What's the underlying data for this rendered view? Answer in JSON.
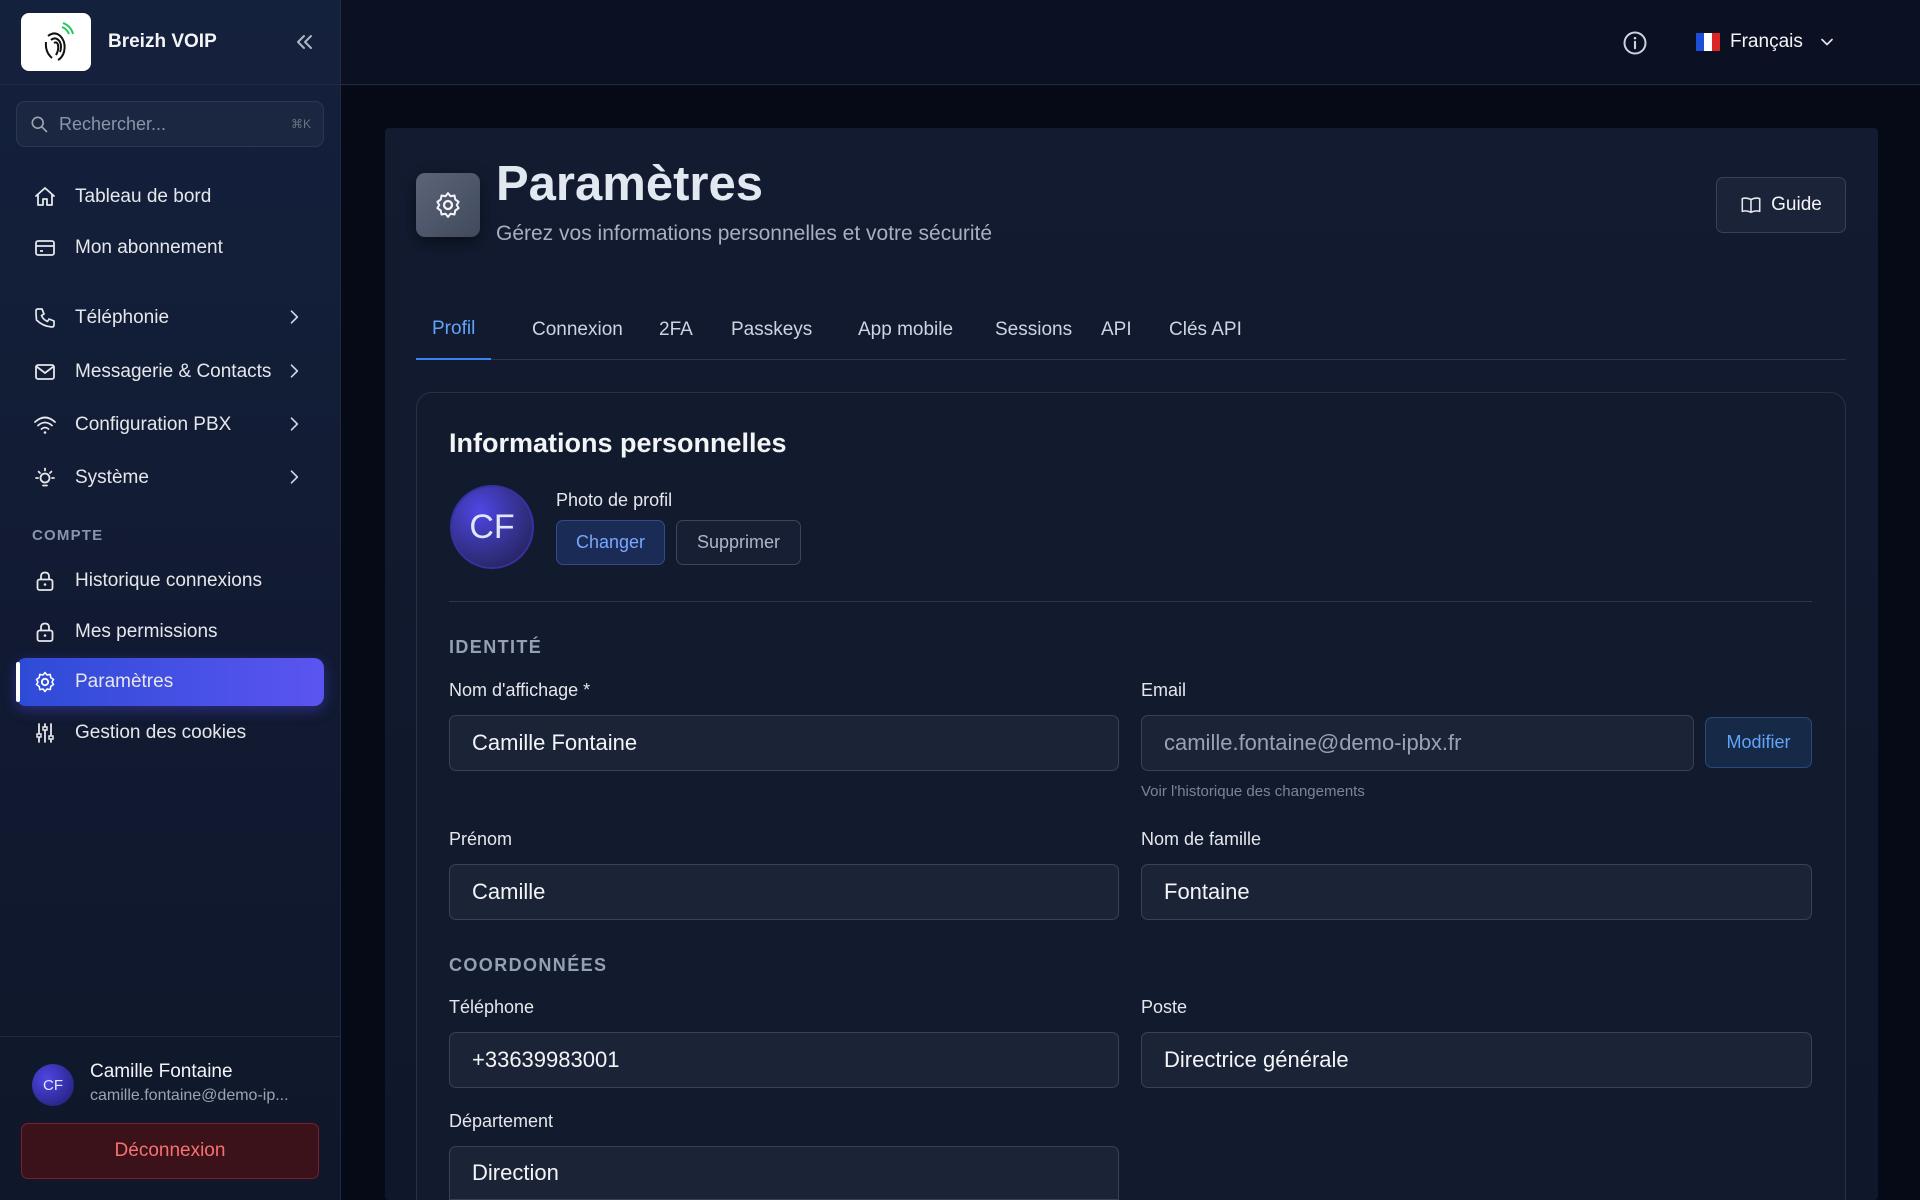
{
  "brand": {
    "name": "Breizh VOIP"
  },
  "search": {
    "placeholder": "Rechercher...",
    "shortcut": "⌘K"
  },
  "sidebar": {
    "items": [
      {
        "label": "Tableau de bord",
        "icon": "home-icon"
      },
      {
        "label": "Mon abonnement",
        "icon": "credit-card-icon"
      },
      {
        "label": "Téléphonie",
        "icon": "phone-icon",
        "has_children": true
      },
      {
        "label": "Messagerie & Contacts",
        "icon": "mail-icon",
        "has_children": true
      },
      {
        "label": "Configuration PBX",
        "icon": "wifi-icon",
        "has_children": true
      },
      {
        "label": "Système",
        "icon": "lightbulb-icon",
        "has_children": true
      }
    ],
    "section_label": "COMPTE",
    "account_items": [
      {
        "label": "Historique connexions",
        "icon": "lock-icon"
      },
      {
        "label": "Mes permissions",
        "icon": "lock-icon"
      },
      {
        "label": "Paramètres",
        "icon": "gear-icon",
        "active": true
      },
      {
        "label": "Gestion des cookies",
        "icon": "sliders-icon"
      }
    ],
    "user": {
      "initials": "CF",
      "name": "Camille Fontaine",
      "email": "camille.fontaine@demo-ip..."
    },
    "logout_label": "Déconnexion"
  },
  "topbar": {
    "language": "Français",
    "flag_colors": [
      "#1d4ed8",
      "#ffffff",
      "#dc2626"
    ]
  },
  "page": {
    "title": "Paramètres",
    "subtitle": "Gérez vos informations personnelles et votre sécurité",
    "guide_label": "Guide"
  },
  "tabs": [
    {
      "label": "Profil",
      "active": true
    },
    {
      "label": "Connexion"
    },
    {
      "label": "2FA"
    },
    {
      "label": "Passkeys"
    },
    {
      "label": "App mobile"
    },
    {
      "label": "Sessions"
    },
    {
      "label": "API"
    },
    {
      "label": "Clés API"
    }
  ],
  "profile": {
    "card_title": "Informations personnelles",
    "avatar_initials": "CF",
    "photo_label": "Photo de profil",
    "change_label": "Changer",
    "delete_label": "Supprimer",
    "identity_label": "IDENTITÉ",
    "display_name_label": "Nom d'affichage *",
    "display_name": "Camille Fontaine",
    "email_label": "Email",
    "email": "camille.fontaine@demo-ipbx.fr",
    "modify_label": "Modifier",
    "email_history_link": "Voir l'historique des changements",
    "first_name_label": "Prénom",
    "first_name": "Camille",
    "last_name_label": "Nom de famille",
    "last_name": "Fontaine",
    "contact_label": "COORDONNÉES",
    "phone_label": "Téléphone",
    "phone": "+33639983001",
    "position_label": "Poste",
    "position": "Directrice générale",
    "department_label": "Département",
    "department": "Direction"
  },
  "colors": {
    "accent": "#4f46e5",
    "tab_active": "#60a5fa",
    "danger": "#f87171"
  }
}
